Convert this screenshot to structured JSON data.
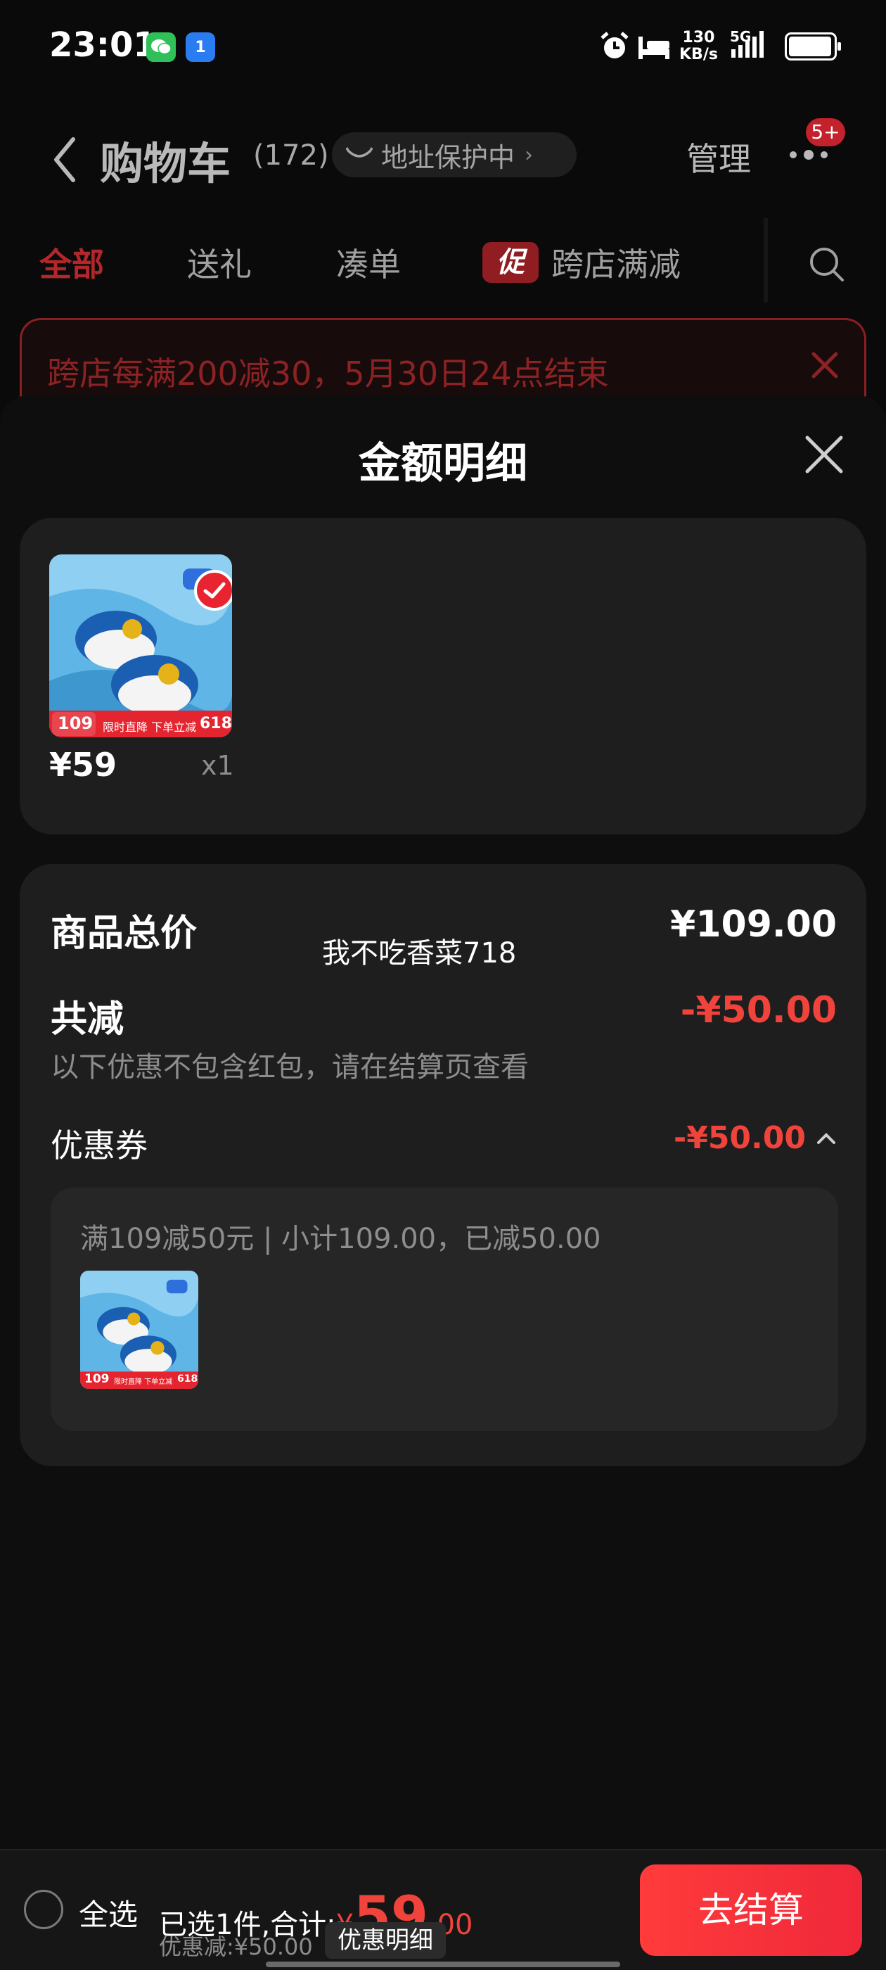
{
  "status_bar": {
    "time": "23:01",
    "net_speed_value": "130",
    "net_speed_unit": "KB/s",
    "network": "5G",
    "hotspot_badge": "1"
  },
  "header": {
    "title": "购物车",
    "count": "(172)",
    "address_label": "地址保护中",
    "manage_label": "管理",
    "more_badge": "5+"
  },
  "tabs": [
    {
      "label": "全部",
      "active": true
    },
    {
      "label": "送礼"
    },
    {
      "label": "凑单"
    },
    {
      "label": "跨店满减",
      "tag": "促"
    }
  ],
  "banner": {
    "text": "跨店每满200减30，5月30日24点结束"
  },
  "sheet": {
    "title": "金额明细",
    "product": {
      "price": "¥59",
      "qty": "x1",
      "thumb_caption_price": "109",
      "thumb_caption_text": "限时直降 下单立减",
      "thumb_caption_tag": "618"
    },
    "summary": {
      "total_label": "商品总价",
      "total_value": "¥109.00",
      "watermark": "我不吃香菜718",
      "discount_label": "共减",
      "discount_value": "-¥50.00",
      "discount_note": "以下优惠不包含红包，请在结算页查看",
      "coupon_label": "优惠券",
      "coupon_value": "-¥50.00",
      "coupon_desc": "满109减50元 | 小计109.00，已减50.00"
    }
  },
  "bottom_bar": {
    "select_all": "全选",
    "selected_prefix": "已选1件,合计:",
    "currency": "¥",
    "amount": "59",
    "cents": ".00",
    "saved": "优惠减:¥50.00",
    "detail_button": "优惠明细",
    "checkout_button": "去结算"
  },
  "colors": {
    "accent_red": "#f0433c",
    "tab_active": "#b3262a",
    "card_bg": "#1e1e1e"
  }
}
